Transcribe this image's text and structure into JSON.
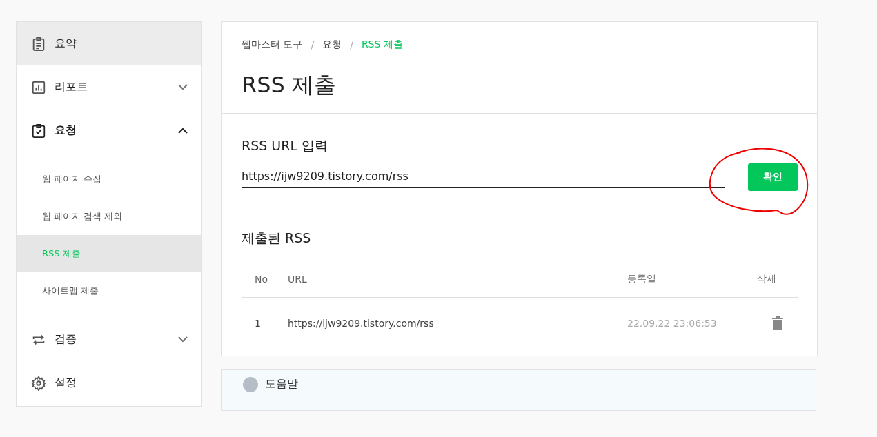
{
  "sidebar": {
    "items": [
      {
        "label": "요약",
        "selected": true
      },
      {
        "label": "리포트",
        "expanded": false,
        "selected": false
      },
      {
        "label": "요청",
        "expanded": true,
        "selected": false,
        "children": [
          {
            "label": "웹 페이지 수집",
            "selected": false
          },
          {
            "label": "웹 페이지 검색 제외",
            "selected": false
          },
          {
            "label": "RSS 제출",
            "selected": true
          },
          {
            "label": "사이트맵 제출",
            "selected": false
          }
        ]
      },
      {
        "label": "검증",
        "expanded": false,
        "selected": false
      },
      {
        "label": "설정",
        "selected": false
      }
    ]
  },
  "breadcrumb": [
    {
      "label": "웹마스터 도구",
      "selected": false
    },
    {
      "label": "요청",
      "selected": false
    },
    {
      "label": "RSS 제출",
      "selected": true
    }
  ],
  "breadcrumb_separators": [
    "/",
    "/"
  ],
  "title": "RSS 제출",
  "rss_form": {
    "label": "RSS URL 입력",
    "value": "https://ijw9209.tistory.com/rss",
    "button": "확인"
  },
  "submitted": {
    "title": "제출된 RSS",
    "columns": [
      "No",
      "URL",
      "등록일",
      "삭제"
    ],
    "rows": [
      {
        "no": "1",
        "url": "https://ijw9209.tistory.com/rss",
        "date": "22.09.22 23:06:53"
      }
    ]
  },
  "help": {
    "title": "도움말"
  }
}
